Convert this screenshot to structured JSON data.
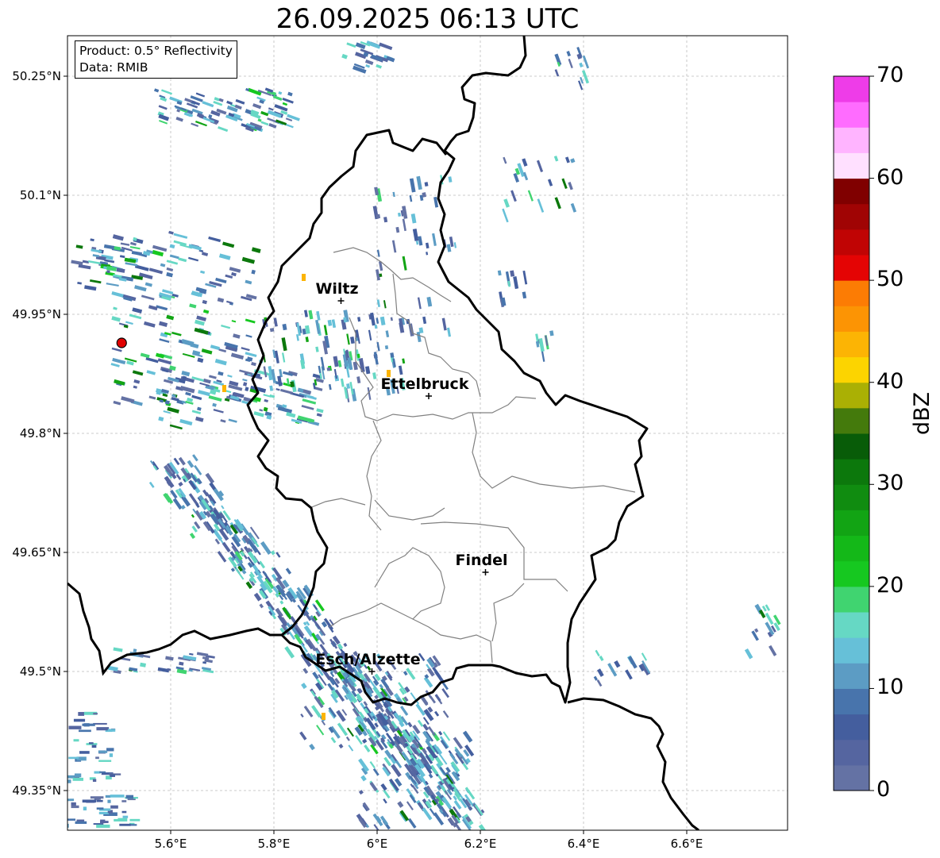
{
  "title": "26.09.2025 06:13 UTC",
  "info": {
    "product": "Product: 0.5° Reflectivity",
    "data": "Data: RMIB"
  },
  "map": {
    "lon_ticks": [
      {
        "label": "5.6°E",
        "lon": 5.6
      },
      {
        "label": "5.8°E",
        "lon": 5.8
      },
      {
        "label": "6°E",
        "lon": 6.0
      },
      {
        "label": "6.2°E",
        "lon": 6.2
      },
      {
        "label": "6.4°E",
        "lon": 6.4
      },
      {
        "label": "6.6°E",
        "lon": 6.6
      }
    ],
    "lat_ticks": [
      {
        "label": "50.25°N",
        "lat": 50.25
      },
      {
        "label": "50.1°N",
        "lat": 50.1
      },
      {
        "label": "49.95°N",
        "lat": 49.95
      },
      {
        "label": "49.8°N",
        "lat": 49.8
      },
      {
        "label": "49.65°N",
        "lat": 49.65
      },
      {
        "label": "49.5°N",
        "lat": 49.5
      },
      {
        "label": "49.35°N",
        "lat": 49.35
      }
    ],
    "cities": [
      {
        "name": "Wiltz",
        "lon": 5.93,
        "lat": 49.967
      },
      {
        "name": "Ettelbruck",
        "lon": 6.1,
        "lat": 49.847
      },
      {
        "name": "Findel",
        "lon": 6.21,
        "lat": 49.625
      },
      {
        "name": "Esch/Alzette",
        "lon": 5.99,
        "lat": 49.5
      }
    ],
    "radar_site": {
      "name": "radar",
      "lon": 5.505,
      "lat": 49.914
    }
  },
  "colorbar": {
    "label": "dBZ",
    "ticks": [
      "0",
      "10",
      "20",
      "30",
      "40",
      "50",
      "60",
      "70"
    ],
    "colors": [
      "#6472a4",
      "#5565a0",
      "#445e9e",
      "#4874ac",
      "#5c9cc4",
      "#66c0d8",
      "#66d8c4",
      "#40d470",
      "#16c820",
      "#14b818",
      "#12a414",
      "#108c10",
      "#0c780c",
      "#085c08",
      "#447a0c",
      "#aab004",
      "#fcd400",
      "#fcb404",
      "#fc9404",
      "#fc7c04",
      "#e40404",
      "#c00404",
      "#a00404",
      "#800000",
      "#ffe0ff",
      "#ffb4ff",
      "#ff6cff",
      "#ee3ce8"
    ]
  }
}
